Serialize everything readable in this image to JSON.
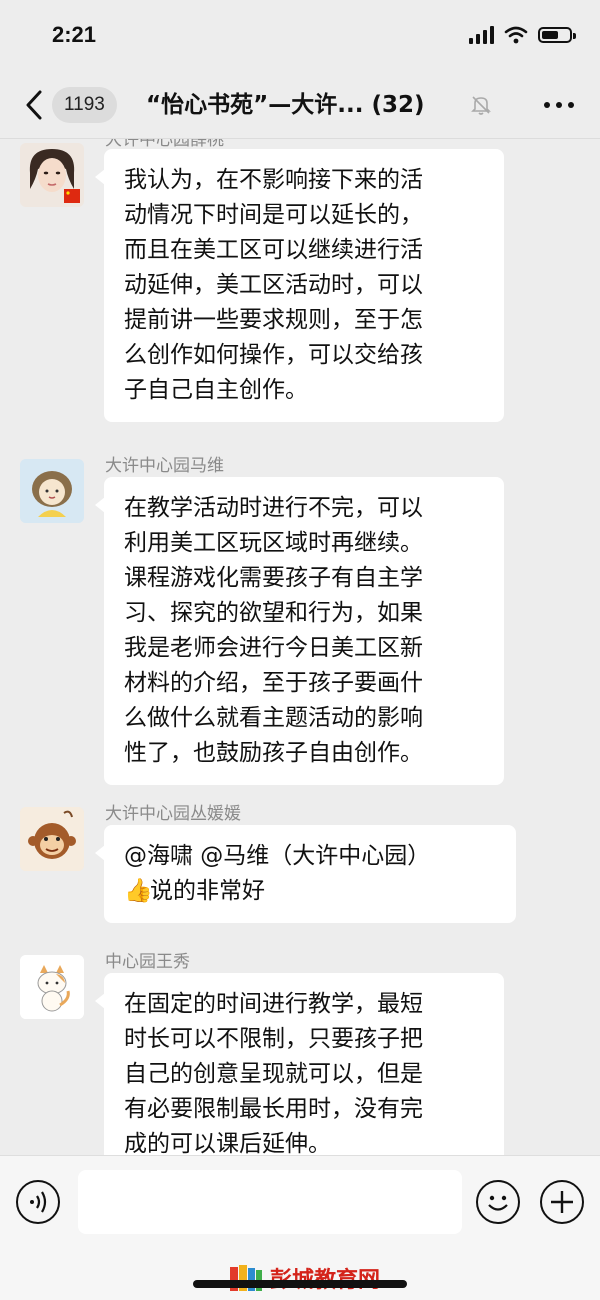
{
  "status_bar": {
    "time": "2:21"
  },
  "nav": {
    "unread_count": "1193",
    "title": "“怡心书苑”—大许...",
    "member_count": "(32)"
  },
  "messages": [
    {
      "sender": "大许中心园薛桃",
      "avatar": "woman-photo-avatar",
      "lines": [
        "我认为，在不影响接下来的活",
        "动情况下时间是可以延长的，",
        "而且在美工区可以继续进行活",
        "动延伸，美工区活动时，可以",
        "提前讲一些要求规则，至于怎",
        "么创作如何操作，可以交给孩",
        "子自己自主创作。"
      ]
    },
    {
      "sender": "大许中心园马维",
      "avatar": "cartoon-girl-avatar",
      "lines": [
        "在教学活动时进行不完，可以",
        "利用美工区玩区域时再继续。",
        "课程游戏化需要孩子有自主学",
        "习、探究的欲望和行为，如果",
        "我是老师会进行今日美工区新",
        "材料的介绍，至于孩子要画什",
        "么做什么就看主题活动的影响",
        "性了，也鼓励孩子自由创作。"
      ]
    },
    {
      "sender": "大许中心园丛媛媛",
      "avatar": "cartoon-monkey-avatar",
      "lines": [
        "@海啸 @马维（大许中心园）",
        "说的非常好"
      ]
    },
    {
      "sender": "中心园王秀",
      "avatar": "cartoon-cat-avatar",
      "lines": [
        "在固定的时间进行教学，最短",
        "时长可以不限制，只要孩子把",
        "自己的创意呈现就可以，但是",
        "有必要限制最长用时，没有完",
        "成的可以课后延伸。"
      ]
    }
  ],
  "watermark": "彭城教育网"
}
